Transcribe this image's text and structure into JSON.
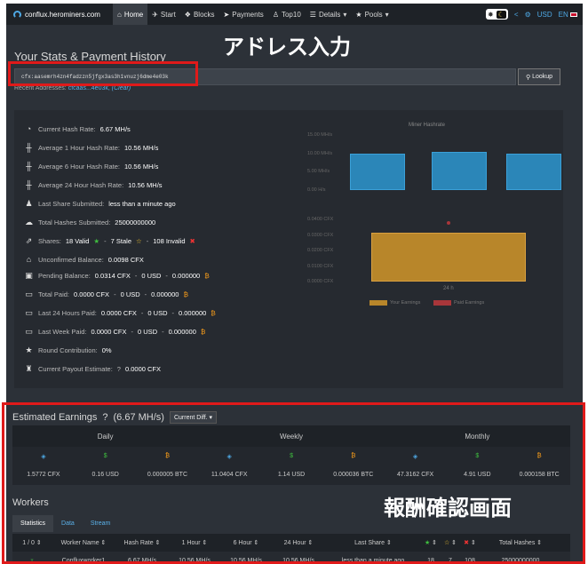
{
  "nav": {
    "brand": "conflux.herominers.com",
    "items": [
      {
        "label": "Home",
        "icon": "home-icon",
        "glyph": "⌂",
        "active": true
      },
      {
        "label": "Start",
        "icon": "rocket-icon",
        "glyph": "✈",
        "active": false
      },
      {
        "label": "Blocks",
        "icon": "cubes-icon",
        "glyph": "❖",
        "active": false
      },
      {
        "label": "Payments",
        "icon": "send-icon",
        "glyph": "➤",
        "active": false
      },
      {
        "label": "Top10",
        "icon": "users-icon",
        "glyph": "♙",
        "active": false
      },
      {
        "label": "Details",
        "icon": "list-icon",
        "glyph": "☰",
        "active": false
      },
      {
        "label": "Pools",
        "icon": "star-icon",
        "glyph": "★",
        "active": false
      }
    ],
    "currency": "USD",
    "language": "EN"
  },
  "stats": {
    "title": "Your Stats & Payment History",
    "address": "cfx:aasemrh4zn4fadzzn5jfgx3as3h1vnuzj6dme4e03k",
    "lookup_label": "Lookup",
    "recent_label": "Recent Addresses:",
    "recent_address": "cfcaas...4e03k,",
    "clear_label": "(Clear)",
    "rows": [
      {
        "label": "Current Hash Rate:",
        "value": "6.67 MH/s",
        "icon": "dashboard-icon",
        "glyph": "◔"
      },
      {
        "label": "Average 1 Hour Hash Rate:",
        "value": "10.56 MH/s",
        "icon": "dumbbell-icon",
        "glyph": "╫"
      },
      {
        "label": "Average 6 Hour Hash Rate:",
        "value": "10.56 MH/s",
        "icon": "dumbbell-icon",
        "glyph": "╫"
      },
      {
        "label": "Average 24 Hour Hash Rate:",
        "value": "10.56 MH/s",
        "icon": "dumbbell-icon",
        "glyph": "╫"
      },
      {
        "label": "Last Share Submitted:",
        "value": "less than a minute ago",
        "icon": "user-clock-icon",
        "glyph": "♟"
      },
      {
        "label": "Total Hashes Submitted:",
        "value": "25000000000",
        "icon": "cloud-upload-icon",
        "glyph": "☁"
      }
    ],
    "shares": {
      "label": "Shares:",
      "valid": "18 Valid",
      "stale": "7 Stale",
      "invalid": "108 Invalid"
    },
    "unconfirmed": {
      "label": "Unconfirmed Balance:",
      "value": "0.0098 CFX"
    },
    "money_rows": [
      {
        "label": "Pending Balance:",
        "cfx": "0.0314 CFX",
        "usd": "0 USD",
        "btc": "0.000000",
        "icon": "money-icon"
      },
      {
        "label": "Total Paid:",
        "cfx": "0.0000 CFX",
        "usd": "0 USD",
        "btc": "0.000000",
        "icon": "wallet-icon"
      },
      {
        "label": "Last 24 Hours Paid:",
        "cfx": "0.0000 CFX",
        "usd": "0 USD",
        "btc": "0.000000",
        "icon": "wallet-icon"
      },
      {
        "label": "Last Week Paid:",
        "cfx": "0.0000 CFX",
        "usd": "0 USD",
        "btc": "0.000000",
        "icon": "wallet-icon"
      }
    ],
    "round_contribution": {
      "label": "Round Contribution:",
      "value": "0%"
    },
    "payout_estimate": {
      "label": "Current Payout Estimate:",
      "value": "0.0000 CFX"
    }
  },
  "chart_data": {
    "type": "bar",
    "title": "Miner Hashrate",
    "hashrate_ticks": [
      "15.00 MH/s",
      "10.00 MH/s",
      "5.00 MH/s",
      "0.00 H/s"
    ],
    "hashrate_values": [
      10.0,
      10.5,
      10.0
    ],
    "earnings_ticks": [
      "0.0400 CFX",
      "0.0300 CFX",
      "0.0200 CFX",
      "0.0100 CFX",
      "0.0000 CFX"
    ],
    "categories": [
      "24 h"
    ],
    "series": [
      {
        "name": "Your Earnings",
        "values": [
          0.0314
        ],
        "color": "#b8862a"
      },
      {
        "name": "Paid Earnings",
        "values": [
          0.0
        ],
        "color": "#a8363a"
      }
    ],
    "marker_value": 0.0375,
    "hashrate_color": "#2b86b8",
    "legend": "bottom"
  },
  "earnings": {
    "title": "Estimated Earnings",
    "rate": "(6.67 MH/s)",
    "dropdown": "Current Diff.",
    "periods": [
      "Daily",
      "Weekly",
      "Monthly"
    ],
    "unit_icons": [
      {
        "name": "cfx-icon",
        "glyph": "◈",
        "color": "#4ea9e5"
      },
      {
        "name": "dollar-icon",
        "glyph": "$",
        "color": "#3fbf3f"
      },
      {
        "name": "bitcoin-icon",
        "glyph": "₿",
        "color": "#f59b1a"
      }
    ],
    "values": [
      "1.5772 CFX",
      "0.16 USD",
      "0.000005 BTC",
      "11.0404 CFX",
      "1.14 USD",
      "0.000036 BTC",
      "47.3162 CFX",
      "4.91 USD",
      "0.000158 BTC"
    ]
  },
  "workers": {
    "title": "Workers",
    "tabs": [
      "Statistics",
      "Data",
      "Stream"
    ],
    "columns": [
      "1 / 0",
      "Worker Name",
      "Hash Rate",
      "1 Hour",
      "6 Hour",
      "24 Hour",
      "Last Share",
      "",
      "",
      "",
      "Total Hashes"
    ],
    "row": [
      "",
      "Confluxworker1",
      "6.67 MH/s",
      "10.56 MH/s",
      "10.56 MH/s",
      "10.56 MH/s",
      "less than a minute ago",
      "18",
      "7",
      "108",
      "25000000000"
    ]
  },
  "annotations": {
    "address_callout": "アドレス入力",
    "earnings_callout": "報酬確認画面"
  }
}
